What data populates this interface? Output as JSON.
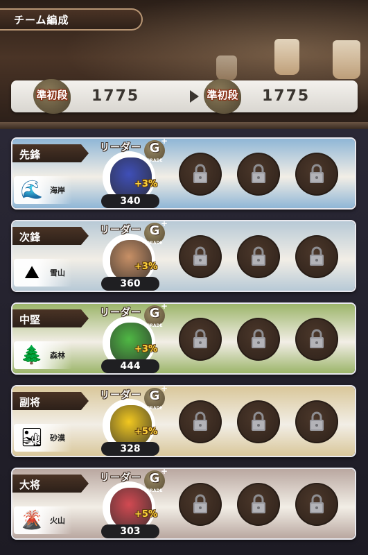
{
  "header": {
    "title": "チーム編成"
  },
  "rank": {
    "current": {
      "badge": "準初段",
      "value": "1775"
    },
    "next": {
      "badge": "準初段",
      "value": "1775"
    }
  },
  "leader_label": "リーダー",
  "grade": {
    "letter": "G",
    "plus": "+",
    "caption": "GRADE"
  },
  "slots": [
    {
      "position": "先鋒",
      "terrain": "海岸",
      "terrain_icon": "wave-icon",
      "bonus": "+3%",
      "power": "340",
      "scene_color": "#8fb6d6",
      "creature_color": "#3f4fb8"
    },
    {
      "position": "次鋒",
      "terrain": "雪山",
      "terrain_icon": "snow-mountain-icon",
      "bonus": "+3%",
      "power": "360",
      "scene_color": "#b7c9d6",
      "creature_color": "#c89066"
    },
    {
      "position": "中堅",
      "terrain": "森林",
      "terrain_icon": "forest-icon",
      "bonus": "+3%",
      "power": "444",
      "scene_color": "#9cb56a",
      "creature_color": "#4fb844"
    },
    {
      "position": "副将",
      "terrain": "砂漠",
      "terrain_icon": "desert-icon",
      "bonus": "+5%",
      "power": "328",
      "scene_color": "#d9c79a",
      "creature_color": "#f2c820"
    },
    {
      "position": "大将",
      "terrain": "火山",
      "terrain_icon": "volcano-icon",
      "bonus": "+5%",
      "power": "303",
      "scene_color": "#b9a7a0",
      "creature_color": "#d24a52"
    }
  ]
}
